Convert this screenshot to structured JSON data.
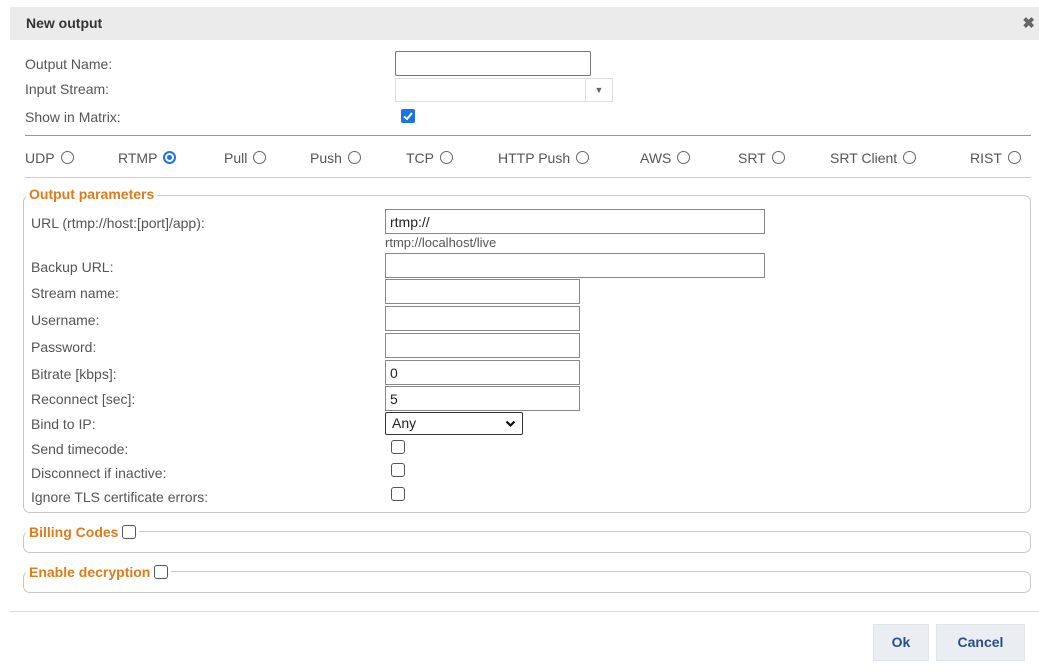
{
  "dialog": {
    "title": "New output",
    "close_glyph": "✖"
  },
  "top_fields": {
    "output_name_label": "Output Name:",
    "output_name_value": "",
    "input_stream_label": "Input Stream:",
    "input_stream_value": "",
    "show_in_matrix_label": "Show in Matrix:",
    "show_in_matrix_checked": true
  },
  "protocols": [
    {
      "label": "UDP",
      "selected": false
    },
    {
      "label": "RTMP",
      "selected": true
    },
    {
      "label": "Pull",
      "selected": false
    },
    {
      "label": "Push",
      "selected": false
    },
    {
      "label": "TCP",
      "selected": false
    },
    {
      "label": "HTTP Push",
      "selected": false
    },
    {
      "label": "AWS",
      "selected": false
    },
    {
      "label": "SRT",
      "selected": false
    },
    {
      "label": "SRT Client",
      "selected": false
    },
    {
      "label": "RIST",
      "selected": false
    }
  ],
  "output_parameters": {
    "legend": "Output parameters",
    "url_label": "URL (rtmp://host:[port]/app):",
    "url_value": "rtmp://",
    "url_hint": "rtmp://localhost/live",
    "backup_url_label": "Backup URL:",
    "backup_url_value": "",
    "stream_name_label": "Stream name:",
    "stream_name_value": "",
    "username_label": "Username:",
    "username_value": "",
    "password_label": "Password:",
    "password_value": "",
    "bitrate_label": "Bitrate [kbps]:",
    "bitrate_value": "0",
    "reconnect_label": "Reconnect [sec]:",
    "reconnect_value": "5",
    "bind_ip_label": "Bind to IP:",
    "bind_ip_value": "Any",
    "send_timecode_label": "Send timecode:",
    "disconnect_inactive_label": "Disconnect if inactive:",
    "ignore_tls_label": "Ignore TLS certificate errors:"
  },
  "billing": {
    "legend": "Billing Codes"
  },
  "decryption": {
    "legend": "Enable decryption"
  },
  "buttons": {
    "ok": "Ok",
    "cancel": "Cancel"
  },
  "colors": {
    "accent_blue": "#1a73e8",
    "legend_orange": "#e07b19",
    "button_text": "#2a4d8a"
  }
}
